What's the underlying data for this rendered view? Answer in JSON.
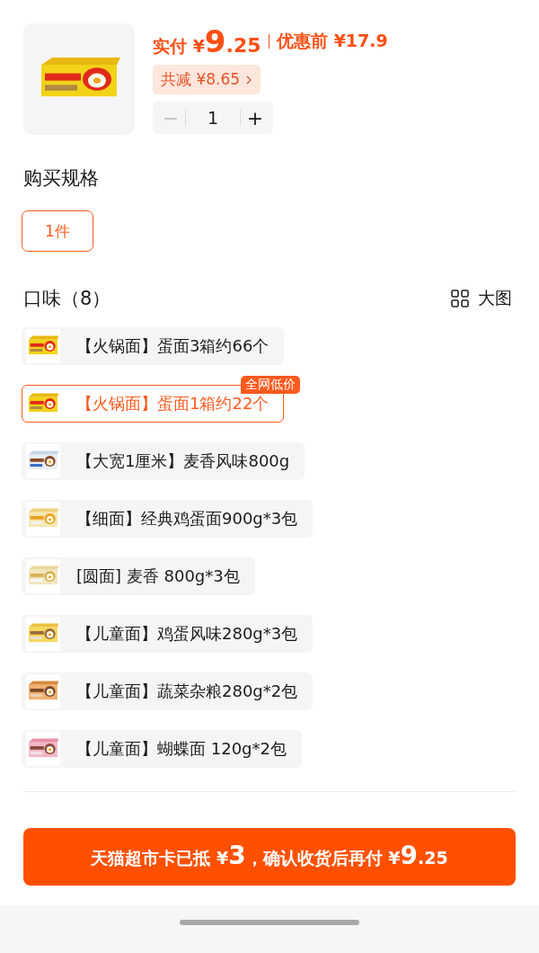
{
  "price": {
    "label": "实付",
    "currency": "¥",
    "integer": "9",
    "decimal": ".25",
    "original": "优惠前 ¥17.9"
  },
  "discount": {
    "text": "共减 ¥8.65"
  },
  "stepper": {
    "minus": "−",
    "quantity": "1",
    "plus": "+",
    "minus_disabled": true
  },
  "spec": {
    "title": "购买规格",
    "options": [
      {
        "label": "1件",
        "selected": true
      }
    ]
  },
  "flavor": {
    "title": "口味（8）",
    "view_label": "大图",
    "options": [
      {
        "label": "【火锅面】蛋面3箱约66个",
        "selected": false
      },
      {
        "label": "【火锅面】蛋面1箱约22个",
        "selected": true,
        "badge": "全网低价"
      },
      {
        "label": "【大宽1厘米】麦香风味800g",
        "selected": false
      },
      {
        "label": "【细面】经典鸡蛋面900g*3包",
        "selected": false
      },
      {
        "label": "[圆面] 麦香 800g*3包",
        "selected": false
      },
      {
        "label": "【儿童面】鸡蛋风味280g*3包",
        "selected": false
      },
      {
        "label": "【儿童面】蔬菜杂粮280g*2包",
        "selected": false
      },
      {
        "label": "【儿童面】蝴蝶面 120g*2包",
        "selected": false
      }
    ]
  },
  "confirm_button": {
    "segments": [
      {
        "text": "天猫超市卡已抵 ¥",
        "kind": "text"
      },
      {
        "text": "3",
        "kind": "amount"
      },
      {
        "text": "，确认收货后再付 ¥",
        "kind": "text"
      },
      {
        "text": "9",
        "kind": "amount"
      },
      {
        "text": ".25",
        "kind": "text"
      }
    ]
  }
}
